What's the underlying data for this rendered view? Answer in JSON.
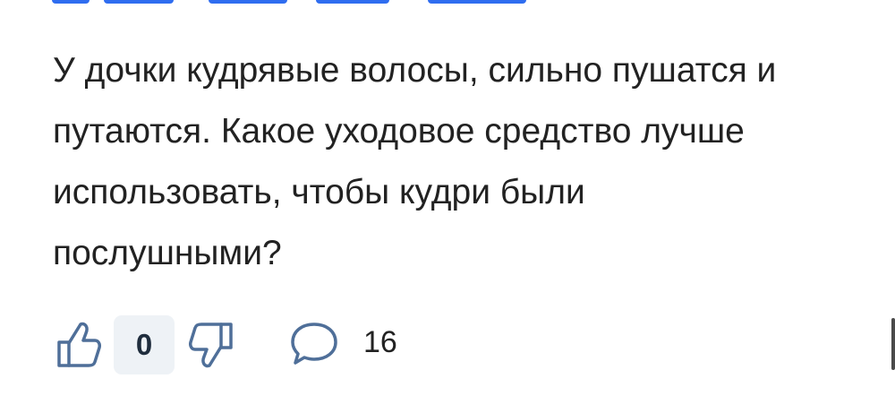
{
  "post": {
    "text": "У дочки кудрявые волосы, сильно пушатся и\nпутаются. Какое уходовое средство лучше\nиспользовать, чтобы кудри были\nпослушными?"
  },
  "actions": {
    "like_icon": "thumbs-up-icon",
    "rating": "0",
    "dislike_icon": "thumbs-down-icon",
    "comment_icon": "speech-bubble-icon",
    "comments_count": "16"
  },
  "colors": {
    "text": "#222222",
    "muted_icon": "#4f6f99",
    "rating_background": "#eef2f6",
    "link_blue": "#2f6df0"
  }
}
